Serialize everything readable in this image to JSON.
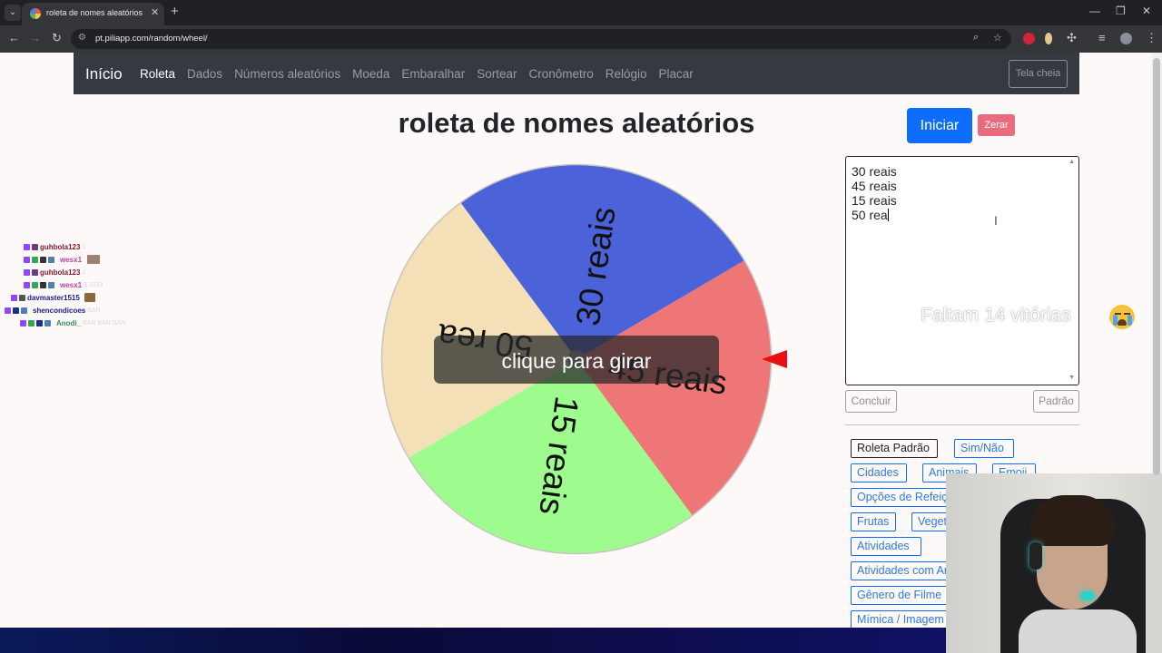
{
  "browser": {
    "tab_title": "roleta de nomes aleatórios",
    "url": "pt.piliapp.com/random/wheel/",
    "icons": [
      "back-icon",
      "forward-icon",
      "reload-icon",
      "site-info-icon",
      "zoom-icon",
      "star-icon",
      "extensions-icon",
      "profile-icon",
      "menu-icon"
    ]
  },
  "navbar": {
    "brand": "Início",
    "links": [
      "Roleta",
      "Dados",
      "Números aleatórios",
      "Moeda",
      "Embaralhar",
      "Sortear",
      "Cronômetro",
      "Relógio",
      "Placar"
    ],
    "fullscreen": "Tela cheia"
  },
  "page": {
    "title": "roleta de nomes aleatórios",
    "spin_prompt": "clique para girar",
    "start_button": "Iniciar",
    "reset_button": "Zerar"
  },
  "wheel": {
    "segments": [
      {
        "label": "30 reais",
        "color": "#4c62d9"
      },
      {
        "label": "45 reais",
        "color": "#ee7677"
      },
      {
        "label": "15 reais",
        "color": "#9efc8f"
      },
      {
        "label": "50 rea",
        "color": "#f4e0b6"
      }
    ],
    "pointer_color": "#e81010"
  },
  "names_box": {
    "lines": [
      "30 reais",
      "45 reais",
      "15 reais",
      "50 rea"
    ]
  },
  "actions": {
    "conclude": "Concluir",
    "default": "Padrão"
  },
  "presets": [
    "Roleta Padrão",
    "Sim/Não",
    "Cidades",
    "Animais",
    "Emoji",
    "Opções de Refeição",
    "Frutas",
    "Vegetais",
    "Atividades",
    "Atividades com Amigos",
    "Gênero de Filme",
    "Mímica / Imagem"
  ],
  "stream": {
    "goal_text": "Faltam 14 vitórias",
    "chat": [
      {
        "user": "guhbola123",
        "msg": "1",
        "color": "#8a1a2a"
      },
      {
        "user": "wesx1",
        "msg": "",
        "color": "#c43ea0"
      },
      {
        "user": "guhbola123",
        "msg": "2",
        "color": "#8a1a2a"
      },
      {
        "user": "wesx1",
        "msg": "3 3333",
        "color": "#c43ea0"
      },
      {
        "user": "davmaster1515",
        "msg": "",
        "color": "#1a1a8a"
      },
      {
        "user": "shencondicoes",
        "msg": "BAN",
        "color": "#1a1a8a"
      },
      {
        "user": "Anodi_",
        "msg": "BAN BAN BAN",
        "color": "#3c8a5a"
      }
    ]
  }
}
